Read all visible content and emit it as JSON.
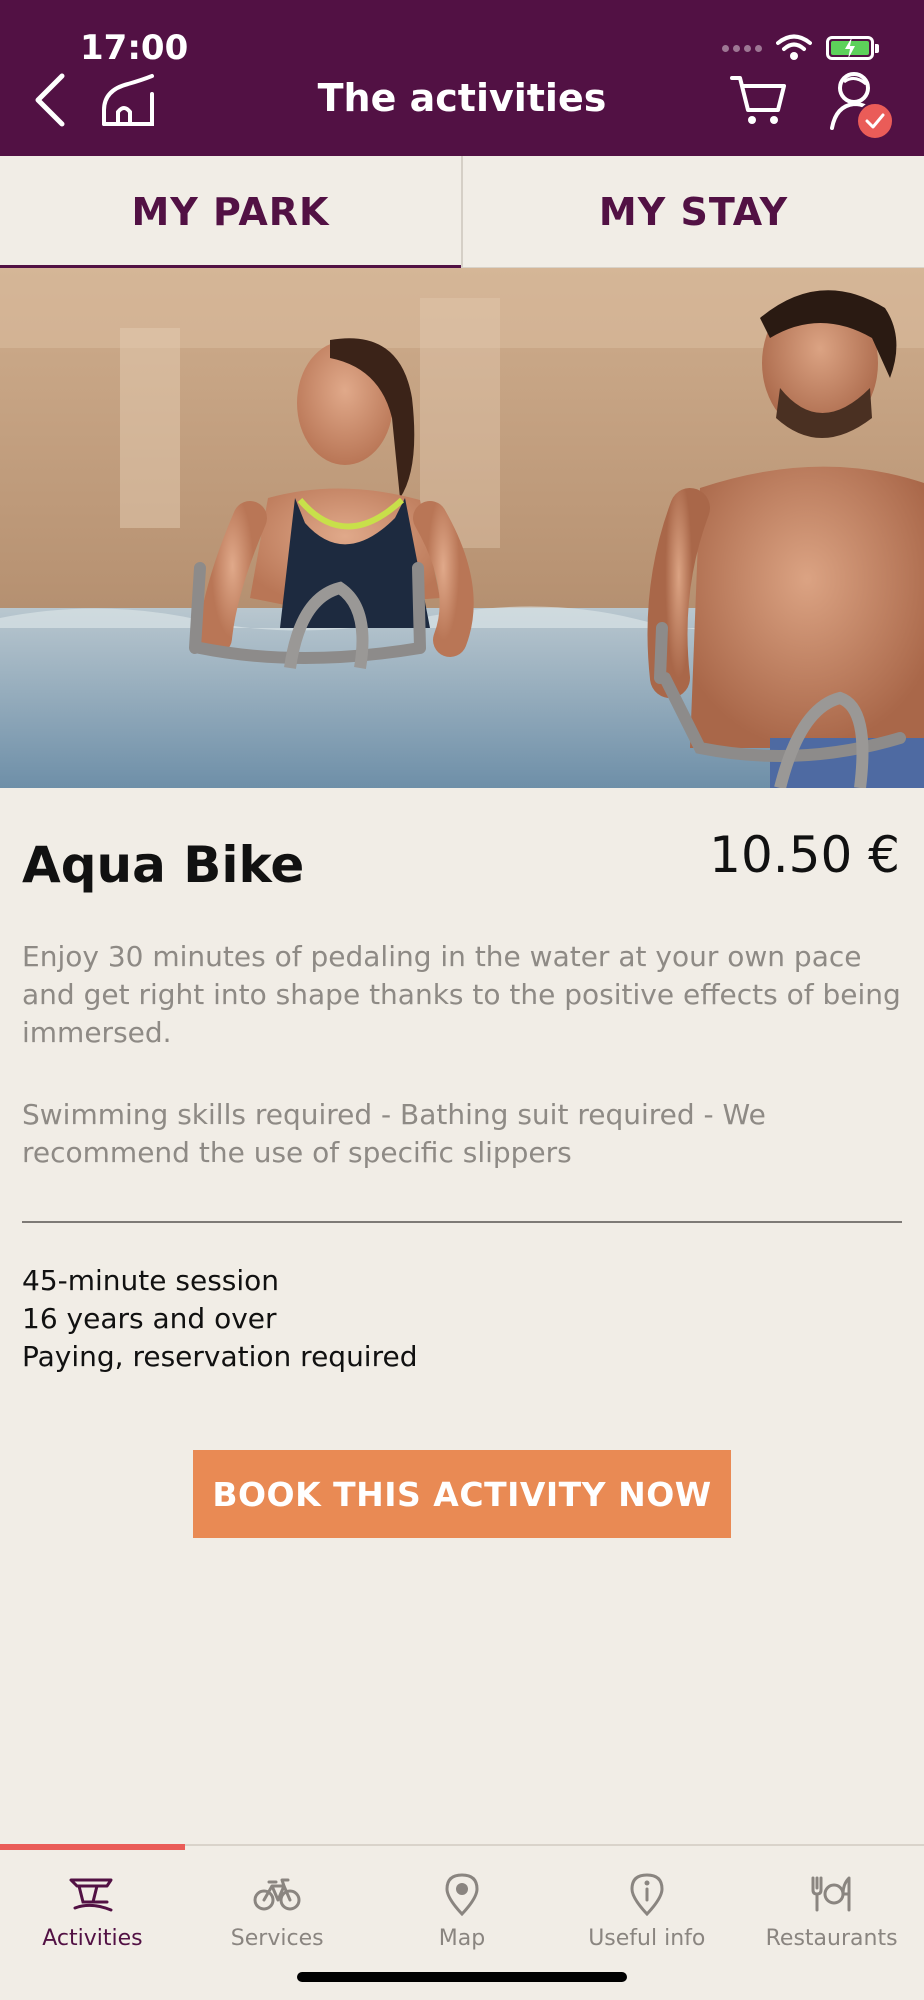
{
  "status_bar": {
    "time": "17:00"
  },
  "header": {
    "title": "The activities"
  },
  "tabs": [
    {
      "label": "MY PARK",
      "active": true
    },
    {
      "label": "MY STAY",
      "active": false
    }
  ],
  "activity": {
    "title": "Aqua Bike",
    "price": "10.50 €",
    "description": "Enjoy 30 minutes of pedaling in the water at your own pace and get right into shape thanks to the positive effects of being immersed.",
    "requirements": "Swimming skills required - Bathing suit required - We recommend the use of specific slippers",
    "details": [
      "45-minute session",
      "16 years and over",
      "Paying, reservation required"
    ],
    "book_button": "BOOK THIS ACTIVITY NOW"
  },
  "bottom_nav": [
    {
      "label": "Activities",
      "icon": "activities-icon",
      "active": true
    },
    {
      "label": "Services",
      "icon": "bicycle-icon",
      "active": false
    },
    {
      "label": "Map",
      "icon": "map-pin-icon",
      "active": false
    },
    {
      "label": "Useful info",
      "icon": "info-icon",
      "active": false
    },
    {
      "label": "Restaurants",
      "icon": "restaurant-icon",
      "active": false
    }
  ],
  "colors": {
    "brand": "#521144",
    "accent": "#e98a54",
    "badge": "#ea5c58",
    "background": "#f1ede6"
  }
}
